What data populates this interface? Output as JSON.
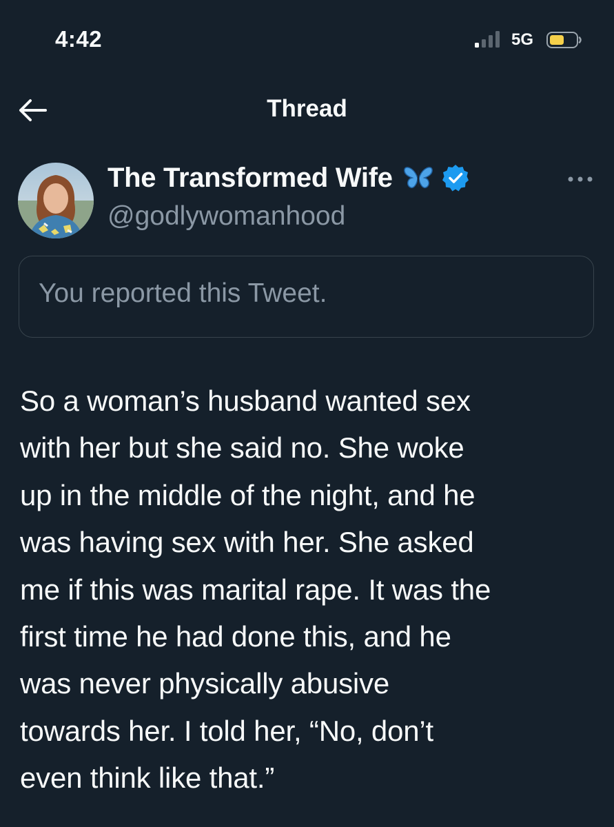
{
  "status_bar": {
    "time": "4:42",
    "network": "5G",
    "battery_color": "#f5d04a"
  },
  "nav": {
    "title": "Thread"
  },
  "tweet": {
    "author": {
      "name": "The Transformed Wife",
      "handle": "@godlywomanhood",
      "badge_emoji": "butterfly-icon",
      "verified": true
    },
    "report_notice": "You reported this Tweet.",
    "lines": [
      "So a woman’s husband wanted sex",
      "with her but she said no. She woke",
      "up in the middle of the night, and he",
      "was having sex with her. She asked",
      "me if this was marital rape. It was the",
      "first time he had done this, and he",
      "was never physically abusive",
      "towards her. I told her, “No, don’t",
      "even think like that.”"
    ]
  },
  "colors": {
    "background": "#15202b",
    "text": "#f7f9f9",
    "secondary_text": "#8b98a5",
    "border": "#38444d",
    "verified_blue": "#1d9bf0"
  }
}
